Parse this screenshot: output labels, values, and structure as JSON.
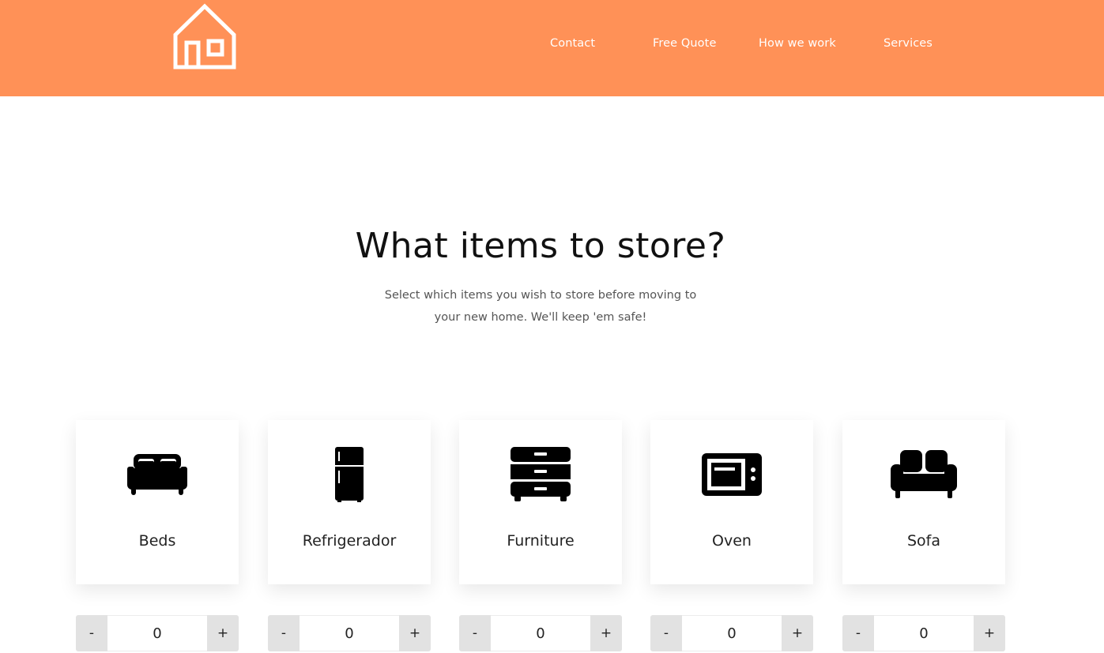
{
  "header": {
    "logo_icon": "house-outline-icon",
    "background": "#ff9157",
    "nav": [
      {
        "label": "Contact"
      },
      {
        "label": "Free Quote"
      },
      {
        "label": "How we work"
      },
      {
        "label": "Services"
      }
    ]
  },
  "hero": {
    "title": "What items to store?",
    "subtitle": "Select which items you wish to store before moving to your new home. We'll keep 'em safe!"
  },
  "items": [
    {
      "label": "Beds",
      "icon": "bed-icon",
      "quantity": "0"
    },
    {
      "label": "Refrigerador",
      "icon": "refrigerator-icon",
      "quantity": "0"
    },
    {
      "label": "Furniture",
      "icon": "dresser-icon",
      "quantity": "0"
    },
    {
      "label": "Oven",
      "icon": "microwave-oven-icon",
      "quantity": "0"
    },
    {
      "label": "Sofa",
      "icon": "sofa-icon",
      "quantity": "0"
    }
  ],
  "stepper": {
    "minus_label": "-",
    "plus_label": "+"
  }
}
